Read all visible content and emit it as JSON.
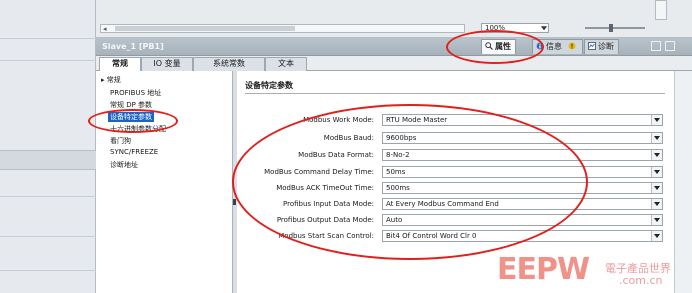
{
  "toolbar": {
    "zoom_value": "100%"
  },
  "inspector": {
    "title": "Slave_1 [PB1]",
    "tabs": [
      {
        "label": "属性",
        "active": true,
        "icon": "properties-icon"
      },
      {
        "label": "信息",
        "active": false,
        "icon": "info-icon"
      },
      {
        "label": "诊断",
        "active": false,
        "icon": "diagnostics-icon"
      }
    ]
  },
  "tabs": [
    {
      "label": "常规",
      "active": true
    },
    {
      "label": "IO 变量",
      "active": false
    },
    {
      "label": "系统常数",
      "active": false
    },
    {
      "label": "文本",
      "active": false
    }
  ],
  "nav": {
    "items": [
      {
        "label": "常规"
      },
      {
        "label": "PROFIBUS 地址"
      },
      {
        "label": "常规 DP 参数"
      },
      {
        "label": "设备特定参数",
        "selected": true
      },
      {
        "label": "十六进制参数分配"
      },
      {
        "label": "看门狗"
      },
      {
        "label": "SYNC/FREEZE"
      },
      {
        "label": "诊断地址"
      }
    ]
  },
  "section": {
    "title": "设备特定参数"
  },
  "params": [
    {
      "label": "Modbus Work Mode:",
      "value": "RTU Mode Master"
    },
    {
      "label": "ModBus Baud:",
      "value": "9600bps"
    },
    {
      "label": "ModBus Data Format:",
      "value": "8-No-2"
    },
    {
      "label": "ModBus Command Delay Time:",
      "value": "50ms"
    },
    {
      "label": "ModBus ACK TimeOut Time:",
      "value": "500ms"
    },
    {
      "label": "Profibus Input Data Mode:",
      "value": "At Every Modbus Command End"
    },
    {
      "label": "Profibus Output Data Mode:",
      "value": "Auto"
    },
    {
      "label": "Modbus Start Scan Control:",
      "value": "Bit4 Of Control Word Clr 0"
    }
  ],
  "watermark": {
    "logo": "EEPW",
    "cn": "電子產品世界",
    "url": ".com.cn"
  },
  "colors": {
    "highlight_ring": "#e0201c",
    "selection": "#1d63c4"
  }
}
